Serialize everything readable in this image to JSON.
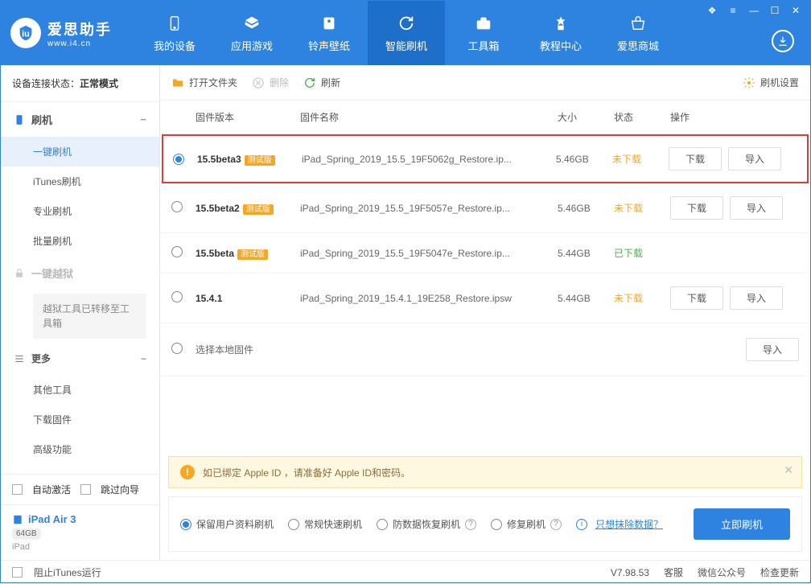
{
  "logo": {
    "title": "爱思助手",
    "sub": "www.i4.cn"
  },
  "nav": [
    {
      "label": "我的设备"
    },
    {
      "label": "应用游戏"
    },
    {
      "label": "铃声壁纸"
    },
    {
      "label": "智能刷机"
    },
    {
      "label": "工具箱"
    },
    {
      "label": "教程中心"
    },
    {
      "label": "爱思商城"
    }
  ],
  "sidebar": {
    "conn_label": "设备连接状态：",
    "conn_value": "正常模式",
    "flash_head": "刷机",
    "items": [
      "一键刷机",
      "iTunes刷机",
      "专业刷机",
      "批量刷机"
    ],
    "jailbreak_head": "一键越狱",
    "jailbreak_notice": "越狱工具已转移至工具箱",
    "more_head": "更多",
    "more_items": [
      "其他工具",
      "下载固件",
      "高级功能"
    ],
    "auto_activate": "自动激活",
    "skip_guide": "跳过向导",
    "device_name": "iPad Air 3",
    "device_cap": "64GB",
    "device_model": "iPad"
  },
  "toolbar": {
    "open_folder": "打开文件夹",
    "delete": "删除",
    "refresh": "刷新",
    "settings": "刷机设置"
  },
  "columns": {
    "version": "固件版本",
    "name": "固件名称",
    "size": "大小",
    "status": "状态",
    "ops": "操作"
  },
  "firmware": [
    {
      "version": "15.5beta3",
      "beta": true,
      "name": "iPad_Spring_2019_15.5_19F5062g_Restore.ip...",
      "size": "5.46GB",
      "status": "未下载",
      "status_class": "not",
      "selected": true,
      "highlight": true,
      "download": true,
      "import": true
    },
    {
      "version": "15.5beta2",
      "beta": true,
      "name": "iPad_Spring_2019_15.5_19F5057e_Restore.ip...",
      "size": "5.46GB",
      "status": "未下载",
      "status_class": "not",
      "selected": false,
      "download": true,
      "import": true
    },
    {
      "version": "15.5beta",
      "beta": true,
      "name": "iPad_Spring_2019_15.5_19F5047e_Restore.ip...",
      "size": "5.44GB",
      "status": "已下载",
      "status_class": "done",
      "selected": false,
      "download": false,
      "import": false
    },
    {
      "version": "15.4.1",
      "beta": false,
      "name": "iPad_Spring_2019_15.4.1_19E258_Restore.ipsw",
      "size": "5.44GB",
      "status": "未下载",
      "status_class": "not",
      "selected": false,
      "download": true,
      "import": true
    }
  ],
  "local_fw": "选择本地固件",
  "btn_download": "下载",
  "btn_import": "导入",
  "beta_tag": "测试版",
  "warn_text": "如已绑定 Apple ID ，请准备好 Apple ID和密码。",
  "flash_options": {
    "keep_data": "保留用户资料刷机",
    "normal": "常规快速刷机",
    "anti_data": "防数据恢复刷机",
    "repair": "修复刷机",
    "erase_link": "只想抹除数据？",
    "flash_btn": "立即刷机"
  },
  "footer": {
    "block_itunes": "阻止iTunes运行",
    "version": "V7.98.53",
    "service": "客服",
    "wechat": "微信公众号",
    "update": "检查更新"
  }
}
